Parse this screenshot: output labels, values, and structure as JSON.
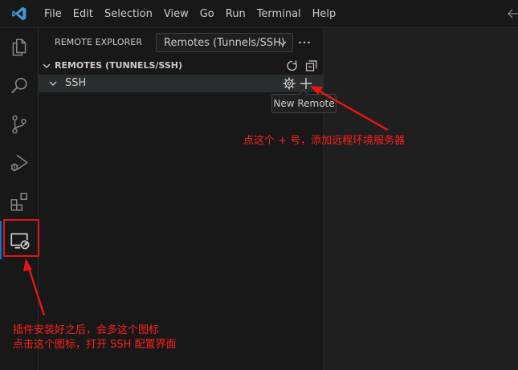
{
  "menu": [
    "File",
    "Edit",
    "Selection",
    "View",
    "Go",
    "Run",
    "Terminal",
    "Help"
  ],
  "sidebar": {
    "title": "REMOTE EXPLORER",
    "select_value": "Remotes (Tunnels/SSH)",
    "section_title": "REMOTES (TUNNELS/SSH)",
    "ssh_label": "SSH"
  },
  "tooltip": "New Remote",
  "annotations": {
    "plus_note": "点这个 + 号，添加远程环境服务器",
    "icon_note_line1": "插件安装好之后，会多这个图标",
    "icon_note_line2": "点击这个图标，打开 SSH 配置界面"
  },
  "colors": {
    "accent": "#0078d4",
    "annotation": "#ff1f1f",
    "logo": "#3c99d4"
  }
}
